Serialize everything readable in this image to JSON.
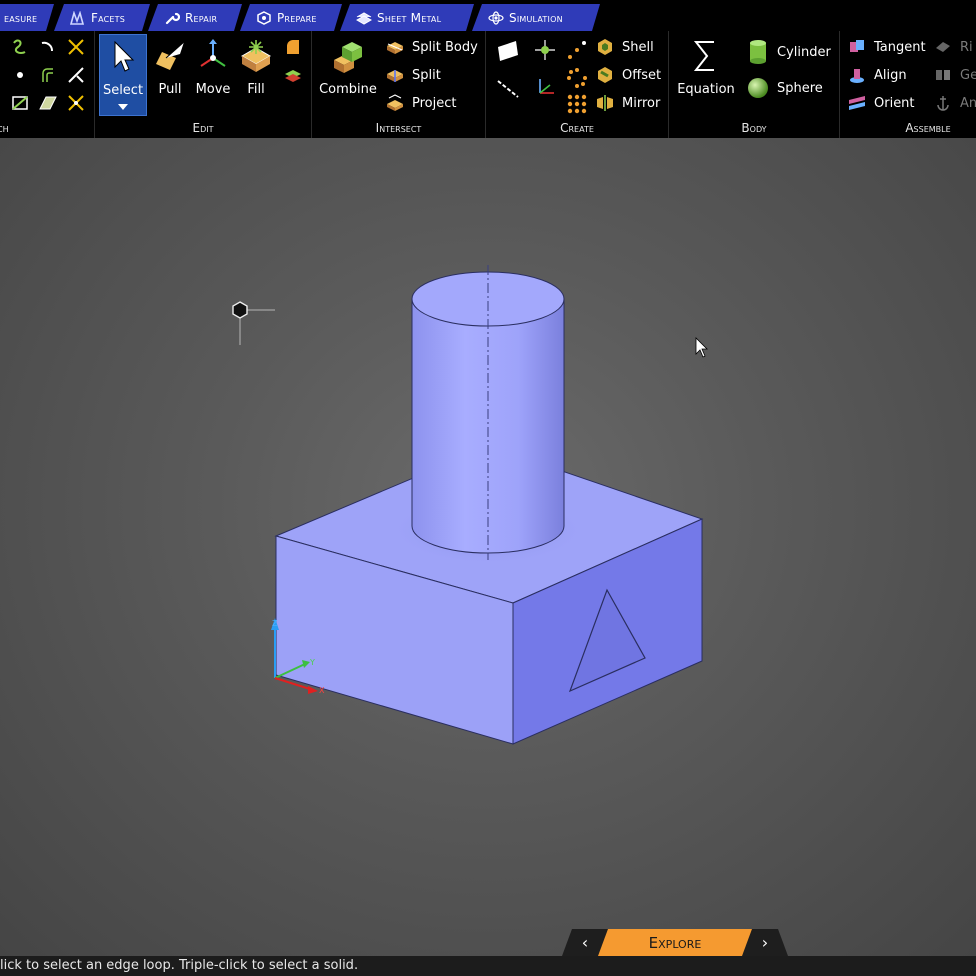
{
  "tabs": [
    {
      "label": "Measure",
      "visible_label": "easure"
    },
    {
      "label": "Facets"
    },
    {
      "label": "Repair"
    },
    {
      "label": "Prepare"
    },
    {
      "label": "Sheet Metal"
    },
    {
      "label": "Simulation"
    }
  ],
  "ribbon": {
    "sketch": {
      "label": "ch"
    },
    "edit": {
      "label": "Edit",
      "select": "Select",
      "pull": "Pull",
      "move": "Move",
      "fill": "Fill"
    },
    "intersect": {
      "label": "Intersect",
      "combine": "Combine",
      "split_body": "Split Body",
      "split": "Split",
      "project": "Project"
    },
    "create": {
      "label": "Create",
      "shell": "Shell",
      "offset": "Offset",
      "mirror": "Mirror"
    },
    "body": {
      "label": "Body",
      "equation": "Equation",
      "cylinder": "Cylinder",
      "sphere": "Sphere"
    },
    "assemble": {
      "label": "Assemble",
      "tangent": "Tangent",
      "align": "Align",
      "orient": "Orient",
      "rigid": "Ri",
      "gear": "Ge",
      "anchor": "An"
    }
  },
  "triad": {
    "z": "Z",
    "y": "Y",
    "x": "X"
  },
  "mode": {
    "label": "Explore",
    "prev": "‹",
    "next": "›"
  },
  "status": "lick to select an edge loop. Triple-click to select a solid.",
  "colors": {
    "tab_blue": "#2f3bb8",
    "model_fill": "#9aa0f5",
    "select_active": "#1f4ea3",
    "mode_orange": "#f59a30"
  }
}
